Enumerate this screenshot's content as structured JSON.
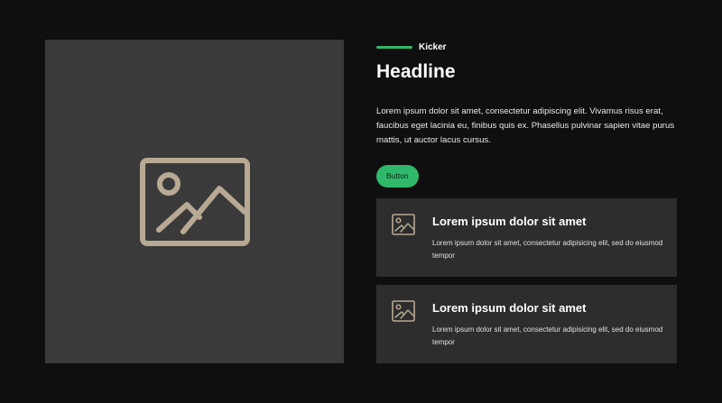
{
  "colors": {
    "accent": "#2fb86a",
    "icon": "#b7a993",
    "media_bg": "#3a3a3a",
    "card_bg": "#2d2d2d"
  },
  "media": {
    "icon": "image-icon"
  },
  "hero": {
    "kicker": "Kicker",
    "headline": "Headline",
    "body": "Lorem ipsum dolor sit amet, consectetur adipiscing elit. Vivamus risus erat, faucibus eget lacinia eu, finibus quis ex. Phasellus pulvinar sapien vitae purus mattis, ut auctor lacus cursus.",
    "button_label": "Button"
  },
  "cards": [
    {
      "icon": "image-icon",
      "title": "Lorem ipsum dolor sit amet",
      "description": "Lorem ipsum dolor sit amet, consectetur adipisicing elit, sed do eiusmod tempor"
    },
    {
      "icon": "image-icon",
      "title": "Lorem ipsum dolor sit amet",
      "description": "Lorem ipsum dolor sit amet, consectetur adipisicing elit, sed do eiusmod tempor"
    }
  ]
}
